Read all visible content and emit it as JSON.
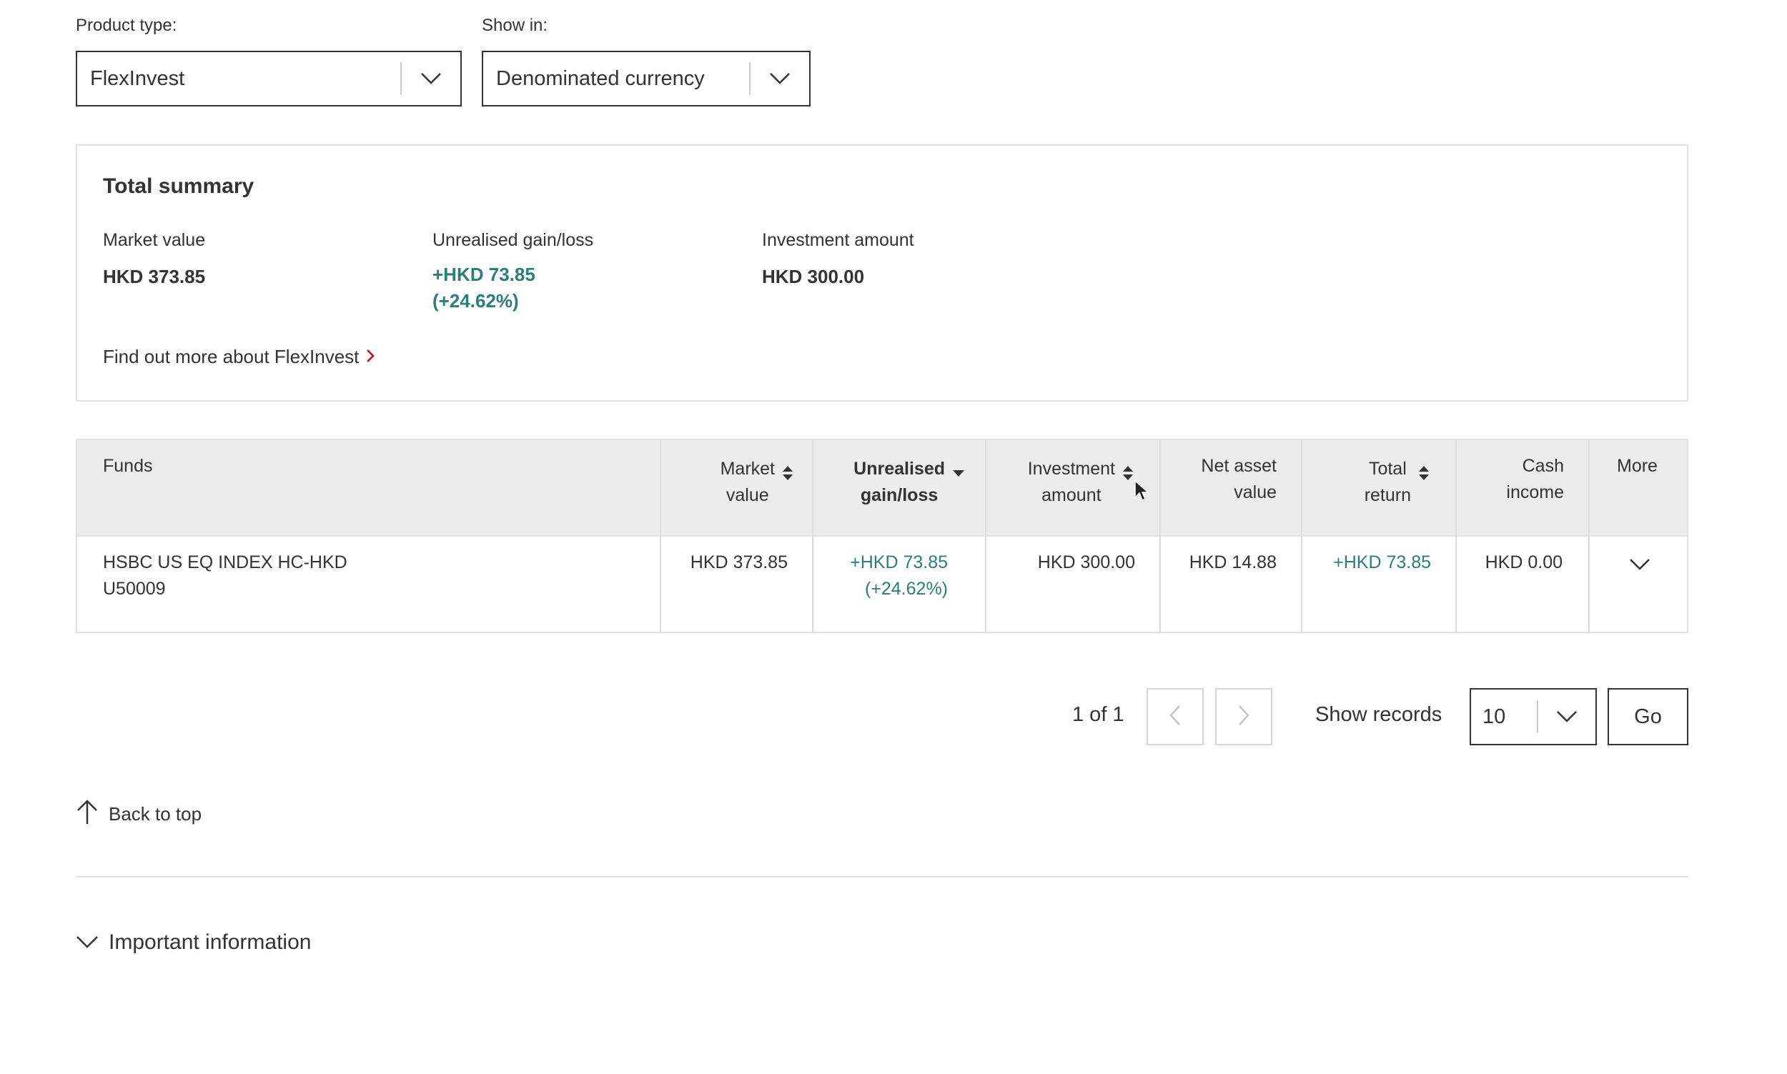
{
  "filters": {
    "product_type": {
      "label": "Product type:",
      "value": "FlexInvest"
    },
    "show_in": {
      "label": "Show in:",
      "value": "Denominated currency"
    }
  },
  "summary": {
    "title": "Total summary",
    "market_value": {
      "label": "Market value",
      "value": "HKD 373.85"
    },
    "unrealised": {
      "label": "Unrealised gain/loss",
      "value_line1": "+HKD 73.85",
      "value_line2": "(+24.62%)"
    },
    "investment_amount": {
      "label": "Investment amount",
      "value": "HKD 300.00"
    },
    "find_more": "Find out more about FlexInvest"
  },
  "table": {
    "headers": {
      "funds": "Funds",
      "market_value_1": "Market",
      "market_value_2": "value",
      "unrealised_1": "Unrealised",
      "unrealised_2": "gain/loss",
      "investment_1": "Investment",
      "investment_2": "amount",
      "nav_1": "Net asset",
      "nav_2": "value",
      "total_return_1": "Total",
      "total_return_2": "return",
      "cash_income_1": "Cash",
      "cash_income_2": "income",
      "more": "More"
    },
    "rows": [
      {
        "fund_name": "HSBC US EQ INDEX HC-HKD",
        "fund_code": "U50009",
        "market_value": "HKD 373.85",
        "unrealised_1": "+HKD 73.85",
        "unrealised_2": "(+24.62%)",
        "investment_amount": "HKD 300.00",
        "nav": "HKD 14.88",
        "total_return": "+HKD 73.85",
        "cash_income": "HKD 0.00"
      }
    ]
  },
  "pagination": {
    "page_info": "1 of 1",
    "show_records_label": "Show records",
    "records_value": "10",
    "go_label": "Go"
  },
  "back_to_top": "Back to top",
  "important_info": "Important information",
  "colors": {
    "gain": "#2b7f7a",
    "accent_red": "#db0011",
    "header_bg": "#ececec",
    "border": "#e1e1e1"
  },
  "icons": [
    "chevron-down-icon",
    "chevron-right-icon",
    "sort-icon",
    "sort-desc-icon",
    "chevron-left-icon",
    "arrow-up-icon",
    "cursor-icon"
  ]
}
